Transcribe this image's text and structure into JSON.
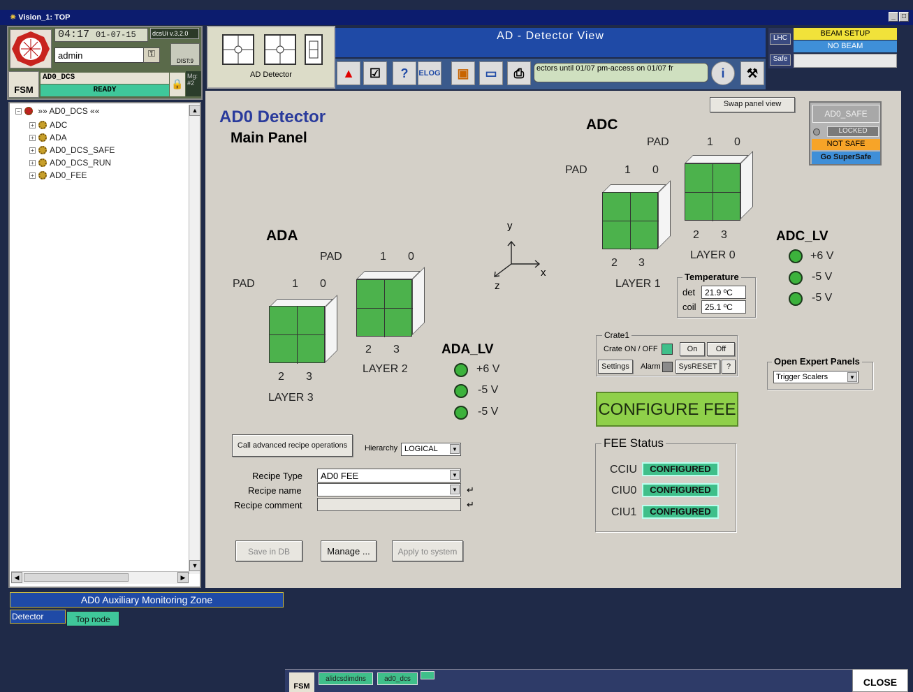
{
  "window": {
    "title": "Vision_1: TOP"
  },
  "header": {
    "time": "04:17",
    "date": "01-07-15",
    "version": "dcsUi v.3.2.0",
    "user": "admin",
    "dist": "DIST:9",
    "fsm_label": "FSM",
    "fsm_node": "AD0_DCS",
    "fsm_state": "READY",
    "mg_label": "Mg:",
    "mg_value": "#2"
  },
  "tree": {
    "root": "»» AD0_DCS ««",
    "items": [
      "ADC",
      "ADA",
      "AD0_DCS_SAFE",
      "AD0_DCS_RUN",
      "AD0_FEE"
    ]
  },
  "panel_toolbar": {
    "label": "AD Detector"
  },
  "banner": {
    "title": "AD - Detector View",
    "marquee": "ectors until 01/07 pm-access on 01/07 fr",
    "elog": "ELOG"
  },
  "lhc": {
    "lhc": "LHC",
    "safe": "Safe",
    "beam_mode": "BEAM SETUP",
    "beam_state": "NO BEAM"
  },
  "main": {
    "title": "AD0 Detector",
    "subtitle": "Main Panel",
    "swap_btn": "Swap panel view",
    "ada": {
      "title": "ADA",
      "pad": "PAD",
      "pad_a": "1",
      "pad_b": "0",
      "pad_c": "2",
      "pad_d": "3",
      "layer2": "LAYER  2",
      "layer3": "LAYER  3"
    },
    "adc": {
      "title": "ADC",
      "pad": "PAD",
      "pad_a": "1",
      "pad_b": "0",
      "pad_c": "2",
      "pad_d": "3",
      "layer0": "LAYER  0",
      "layer1": "LAYER  1"
    },
    "axes": {
      "y": "y",
      "x": "x",
      "z": "z"
    },
    "ada_lv": {
      "title": "ADA_LV",
      "v1": "+6 V",
      "v2": "-5 V",
      "v3": "-5 V"
    },
    "adc_lv": {
      "title": "ADC_LV",
      "v1": "+6 V",
      "v2": "-5 V",
      "v3": "-5 V"
    },
    "temperature": {
      "title": "Temperature",
      "det_label": "det",
      "det_value": "21.9 ºC",
      "coil_label": "coil",
      "coil_value": "25.1 ºC"
    },
    "crate": {
      "title": "Crate1",
      "onoff": "Crate ON / OFF",
      "on": "On",
      "off": "Off",
      "settings": "Settings",
      "alarm": "Alarm",
      "sysreset": "SysRESET",
      "help": "?"
    },
    "expert": {
      "title": "Open Expert Panels",
      "selected": "Trigger Scalers"
    },
    "configure": "CONFIGURE FEE",
    "fee": {
      "title": "FEE Status",
      "rows": [
        {
          "name": "CCIU",
          "status": "CONFIGURED"
        },
        {
          "name": "CIU0",
          "status": "CONFIGURED"
        },
        {
          "name": "CIU1",
          "status": "CONFIGURED"
        }
      ]
    },
    "safe": {
      "title": "AD0_SAFE",
      "locked": "LOCKED",
      "not_safe": "NOT SAFE",
      "go": "Go SuperSafe"
    },
    "recipe": {
      "advanced_btn": "Call advanced recipe operations",
      "hierarchy_label": "Hierarchy",
      "hierarchy_value": "LOGICAL",
      "type_label": "Recipe Type",
      "type_value": "AD0 FEE",
      "name_label": "Recipe name",
      "name_value": "",
      "comment_label": "Recipe comment",
      "comment_value": "",
      "save": "Save in DB",
      "manage": "Manage ...",
      "apply": "Apply to system"
    }
  },
  "aux": {
    "title": "AD0 Auxiliary Monitoring Zone",
    "detector": "Detector",
    "topnode": "Top node"
  },
  "bottom": {
    "fsm": "FSM",
    "task1": "alidcsdimdns",
    "task2": "ad0_dcs",
    "close": "CLOSE"
  },
  "colors": {
    "led_on": "#3cb23c",
    "configured": "#3fbf8a",
    "banner": "#1f4aa6",
    "configure_btn": "#8fd04a"
  }
}
